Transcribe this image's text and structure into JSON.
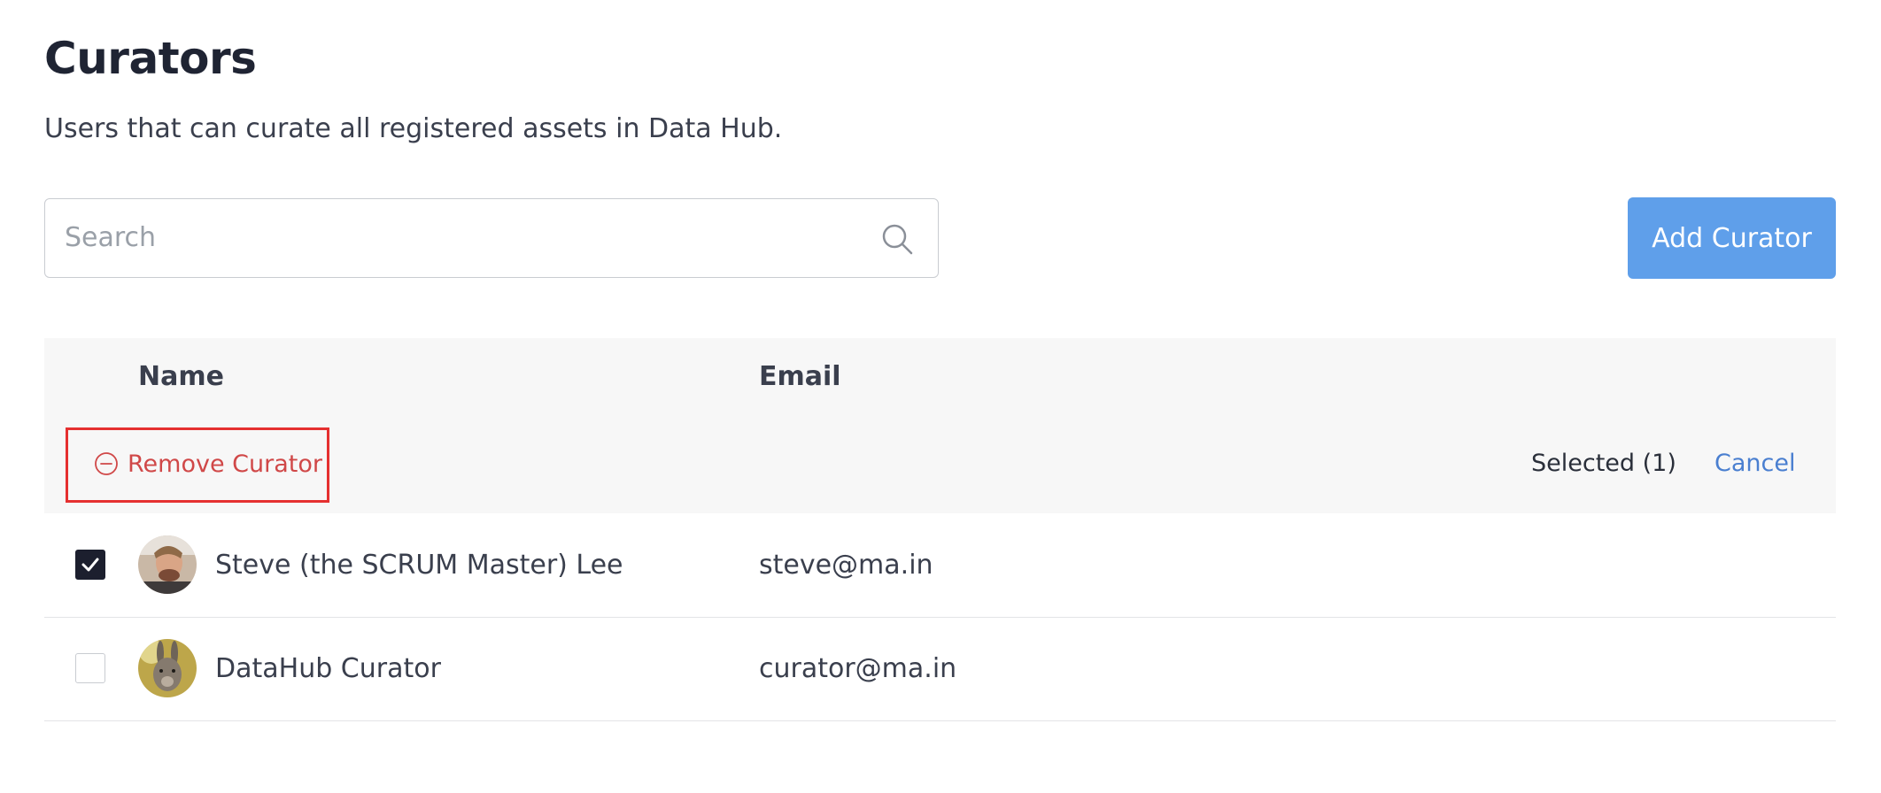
{
  "page": {
    "title": "Curators",
    "subtitle": "Users that can curate all registered assets in Data Hub."
  },
  "search": {
    "placeholder": "Search",
    "value": "",
    "icon": "search-icon"
  },
  "add_button": {
    "label": "Add Curator",
    "color": "#5f9fea"
  },
  "table": {
    "columns": [
      "Name",
      "Email"
    ],
    "bulk_actions": {
      "remove_label": "Remove Curator",
      "remove_icon": "minus-circle-icon",
      "remove_color": "#d04848",
      "selected_label": "Selected (1)",
      "cancel_label": "Cancel"
    },
    "rows": [
      {
        "name": "Steve (the SCRUM Master) Lee",
        "email": "steve@ma.in",
        "checked": true,
        "avatar": "avatar-photo"
      },
      {
        "name": "DataHub Curator",
        "email": "curator@ma.in",
        "checked": false,
        "avatar": "avatar-photo"
      }
    ]
  }
}
